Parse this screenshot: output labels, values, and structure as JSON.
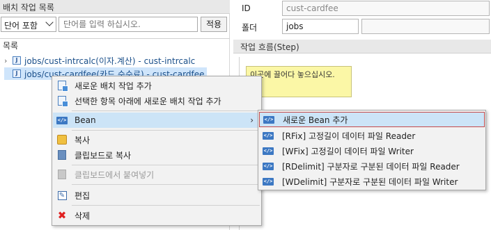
{
  "left_panel": {
    "title": "배치 작업 목록",
    "search_type": "단어 포함",
    "search_placeholder": "단어를 입력 하십시오.",
    "apply_label": "적용",
    "list_label": "목록",
    "tree_items": [
      {
        "label": "jobs/cust-intrcalc(이자.계산) - cust-intrcalc"
      },
      {
        "label": "jobs/cust-cardfee(카드 수수료) - cust-cardfee"
      }
    ]
  },
  "right_panel": {
    "id_label": "ID",
    "id_value": "cust-cardfee",
    "folder_label": "폴더",
    "folder_value": "jobs",
    "folder_extra": "",
    "step_header": "작업 흐름(Step)",
    "drop_hint": "이곳에 끌어다 놓으십시오."
  },
  "context_menu": {
    "items": [
      {
        "label": "새로운 배치 작업 추가",
        "icon": "add-job-icon"
      },
      {
        "label": "선택한 항목 아래에 새로운 배치 작업 추가",
        "icon": "add-job-below-icon"
      },
      {
        "label": "Bean",
        "icon": "bean-icon"
      },
      {
        "label": "복사",
        "icon": "copy-icon"
      },
      {
        "label": "클립보드로 복사",
        "icon": "clipboard-copy-icon"
      },
      {
        "label": "클립보드에서 붙여넣기",
        "icon": "paste-icon"
      },
      {
        "label": "편집",
        "icon": "edit-icon"
      },
      {
        "label": "삭제",
        "icon": "delete-icon"
      }
    ]
  },
  "submenu": {
    "items": [
      {
        "label": "새로운 Bean 추가"
      },
      {
        "label": "[RFix] 고정길이 데이터 파일 Reader"
      },
      {
        "label": "[WFix] 고정길이 데이터 파일 Writer"
      },
      {
        "label": "[RDelimit] 구분자로 구분된 데이터 파일 Reader"
      },
      {
        "label": "[WDelimit] 구분자로 구분된 데이터 파일 Writer"
      }
    ]
  },
  "colors": {
    "selection": "#cce4f7",
    "drop_zone": "#fbf7a6",
    "accent": "#3c78c3"
  }
}
